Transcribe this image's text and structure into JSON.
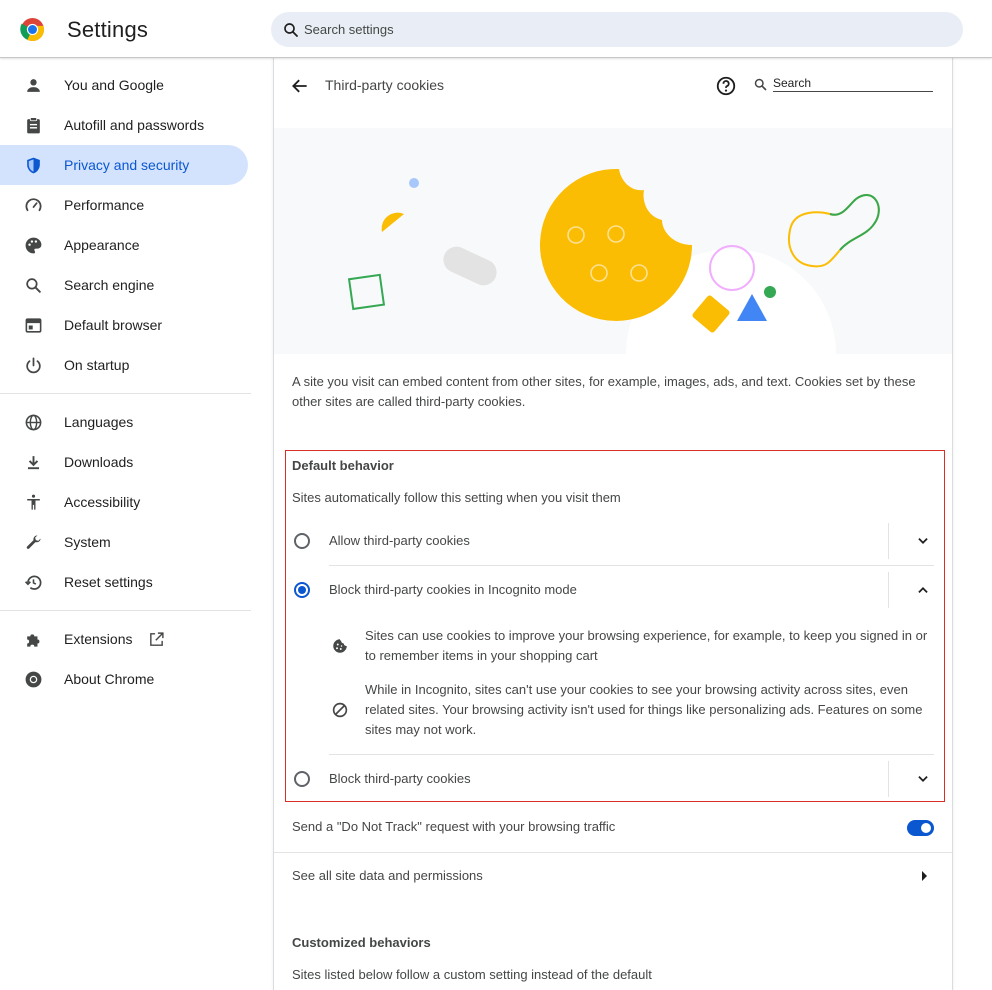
{
  "header": {
    "app_title": "Settings",
    "search_placeholder": "Search settings",
    "logo_icon": "chrome-logo-icon"
  },
  "sidebar": {
    "items": [
      {
        "label": "You and Google",
        "icon": "person-icon"
      },
      {
        "label": "Autofill and passwords",
        "icon": "clipboard-icon"
      },
      {
        "label": "Privacy and security",
        "icon": "shield-icon",
        "active": true
      },
      {
        "label": "Performance",
        "icon": "speedometer-icon"
      },
      {
        "label": "Appearance",
        "icon": "palette-icon"
      },
      {
        "label": "Search engine",
        "icon": "search-icon"
      },
      {
        "label": "Default browser",
        "icon": "browser-window-icon"
      },
      {
        "label": "On startup",
        "icon": "power-icon"
      },
      {
        "label": "Languages",
        "icon": "globe-icon"
      },
      {
        "label": "Downloads",
        "icon": "download-icon"
      },
      {
        "label": "Accessibility",
        "icon": "accessibility-icon"
      },
      {
        "label": "System",
        "icon": "wrench-icon"
      },
      {
        "label": "Reset settings",
        "icon": "history-icon"
      },
      {
        "label": "Extensions",
        "icon": "puzzle-icon",
        "trailing_icon": "open-in-new-icon"
      },
      {
        "label": "About Chrome",
        "icon": "chrome-icon"
      }
    ]
  },
  "subpage": {
    "title": "Third-party cookies",
    "search_placeholder": "Search",
    "description": "A site you visit can embed content from other sites, for example, images, ads, and text. Cookies set by these other sites are called third-party cookies.",
    "default_behavior": {
      "title": "Default behavior",
      "subtitle": "Sites automatically follow this setting when you visit them",
      "options": [
        {
          "label": "Allow third-party cookies",
          "selected": false,
          "expanded": false
        },
        {
          "label": "Block third-party cookies in Incognito mode",
          "selected": true,
          "expanded": true
        },
        {
          "label": "Block third-party cookies",
          "selected": false,
          "expanded": false
        }
      ],
      "details": [
        {
          "icon": "cookie-icon",
          "text": "Sites can use cookies to improve your browsing experience, for example, to keep you signed in or to remember items in your shopping cart"
        },
        {
          "icon": "block-icon",
          "text": "While in Incognito, sites can't use your cookies to see your browsing activity across sites, even related sites. Your browsing activity isn't used for things like personalizing ads. Features on some sites may not work."
        }
      ]
    },
    "do_not_track": {
      "label": "Send a \"Do Not Track\" request with your browsing traffic",
      "enabled": true
    },
    "site_data_link": "See all site data and permissions",
    "customized": {
      "title": "Customized behaviors",
      "subtitle": "Sites listed below follow a custom setting instead of the default"
    }
  },
  "colors": {
    "accent": "#0b57d0",
    "active_nav_bg": "#d3e3fd",
    "highlight_border": "#d93025",
    "cookie_yellow": "#fbbc04"
  }
}
